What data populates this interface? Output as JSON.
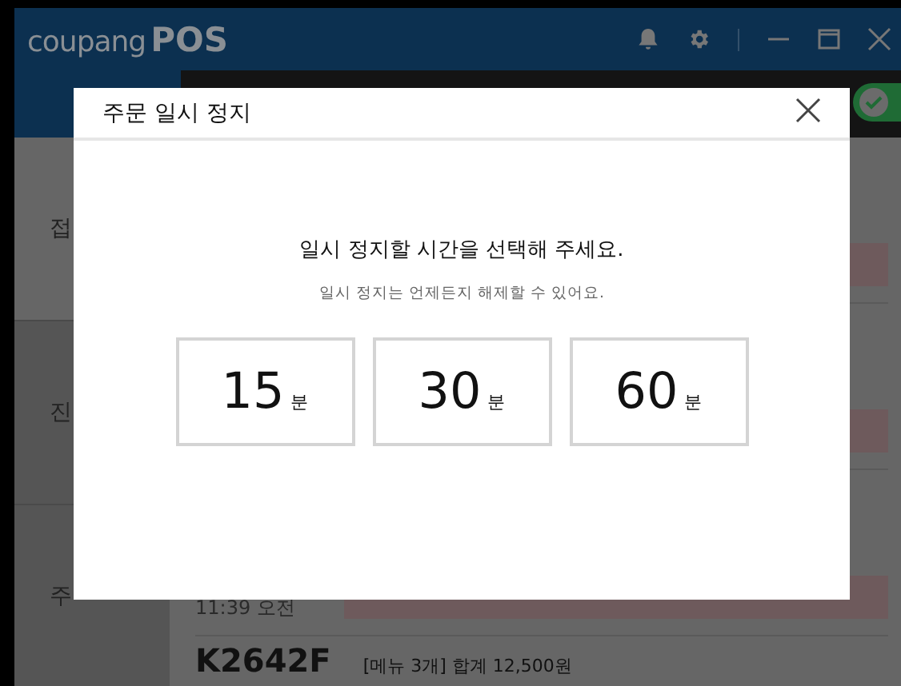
{
  "app": {
    "logo_brand": "coupang",
    "logo_product": "POS"
  },
  "toolbar": {
    "toggle": {
      "on": true
    }
  },
  "sidebar": {
    "items": [
      {
        "label": "접",
        "selected": true
      },
      {
        "label": "진",
        "selected": false
      },
      {
        "label": "주",
        "selected": false
      }
    ]
  },
  "content_rows": [
    {
      "kind": "notice"
    },
    {
      "kind": "notice"
    },
    {
      "kind": "notice",
      "time": "11:39 오전"
    },
    {
      "kind": "order",
      "code": "K2642F",
      "summary": "[메뉴 3개] 합계 12,500원"
    }
  ],
  "dialog": {
    "title": "주문 일시 정지",
    "message": "일시 정지할 시간을 선택해 주세요.",
    "hint": "일시 정지는 언제든지 해제할 수 있어요.",
    "options": [
      {
        "value": "15",
        "unit": "분"
      },
      {
        "value": "30",
        "unit": "분"
      },
      {
        "value": "60",
        "unit": "분"
      }
    ]
  }
}
